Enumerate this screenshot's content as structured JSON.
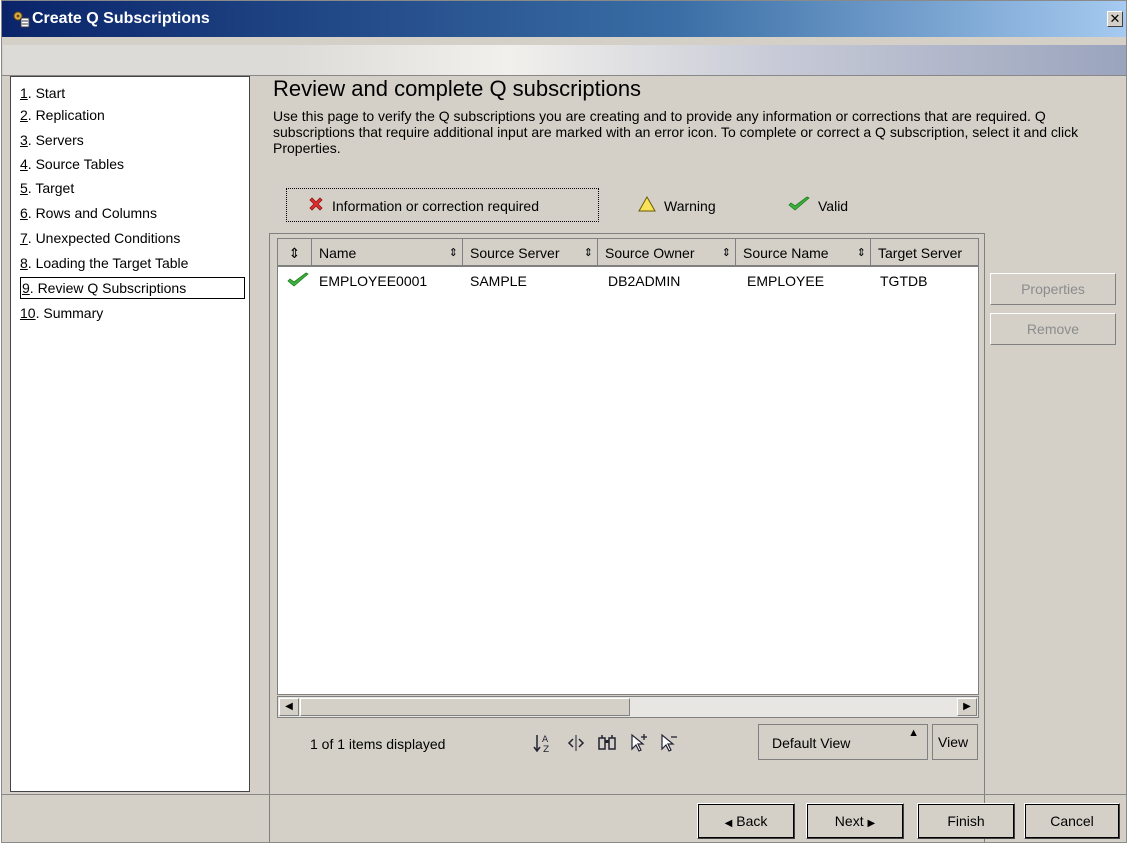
{
  "window": {
    "title": "Create Q Subscriptions",
    "close_glyph": "✕"
  },
  "nav": {
    "items": [
      {
        "num": "1",
        "label": ". Start"
      },
      {
        "num": "2",
        "label": ". Replication"
      },
      {
        "num": "3",
        "label": ". Servers"
      },
      {
        "num": "4",
        "label": ". Source Tables"
      },
      {
        "num": "5",
        "label": ". Target"
      },
      {
        "num": "6",
        "label": ". Rows and Columns"
      },
      {
        "num": "7",
        "label": ". Unexpected Conditions"
      },
      {
        "num": "8",
        "label": ". Loading the Target Table"
      },
      {
        "num": "9",
        "label": ". Review Q Subscriptions",
        "selected": true
      },
      {
        "num": "10",
        "label": ". Summary"
      }
    ]
  },
  "page": {
    "heading": "Review and complete Q subscriptions",
    "description": "Use this page to verify the Q subscriptions you are creating and to provide any information or corrections that are required. Q subscriptions that require additional input are marked with an error icon. To complete or correct a Q subscription, select it and click Properties."
  },
  "legend": {
    "error": "Information or correction required",
    "warning": "Warning",
    "valid": "Valid"
  },
  "table": {
    "headers": [
      "Name",
      "Source Server",
      "Source Owner",
      "Source Name",
      "Target Server"
    ],
    "rows": [
      {
        "status": "valid",
        "cells": [
          "EMPLOYEE0001",
          "SAMPLE",
          "DB2ADMIN",
          "EMPLOYEE",
          "TGTDB"
        ]
      }
    ],
    "status_text": "1 of 1 items displayed",
    "view_select": "Default View",
    "view_button": "View"
  },
  "side_buttons": {
    "properties": "Properties",
    "remove": "Remove"
  },
  "footer": {
    "back": "Back",
    "next": "Next",
    "finish": "Finish",
    "cancel": "Cancel"
  },
  "colors": {
    "title_bar": "#0a246a",
    "dialog_bg": "#d4d0c8",
    "error": "#e03030",
    "warning": "#f0d000",
    "valid": "#3cb43c"
  }
}
